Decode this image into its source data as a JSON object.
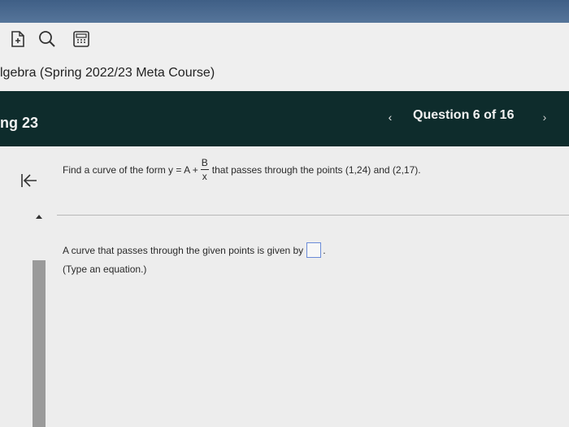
{
  "toolbar": {
    "icons": [
      "document-plus-icon",
      "search-icon",
      "calculator-icon"
    ]
  },
  "course": {
    "title": "lgebra (Spring 2022/23 Meta Course)"
  },
  "header": {
    "assignment_title": "ng 23",
    "prev_symbol": "‹",
    "question_counter": "Question 6 of 16",
    "next_symbol": "›"
  },
  "problem": {
    "text_before": "Find a curve of the form y = A +",
    "fraction_numerator": "B",
    "fraction_denominator": "x",
    "text_after": "that passes through the points (1,24) and (2,17)."
  },
  "answer": {
    "prompt": "A curve that passes through the given points is given by",
    "value": "",
    "trailing": ".",
    "hint": "(Type an equation.)"
  },
  "colors": {
    "header_bg": "#0e2c2c",
    "answer_box_border": "#6a8bd8"
  }
}
